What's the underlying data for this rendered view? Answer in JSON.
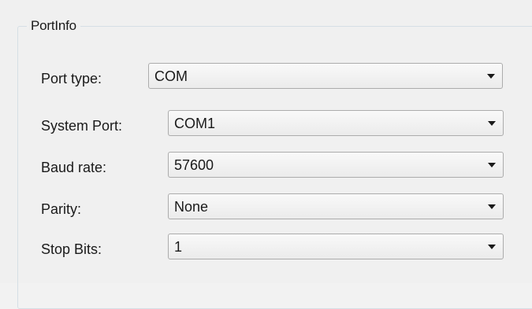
{
  "group": {
    "title": "PortInfo"
  },
  "fields": {
    "port_type": {
      "label": "Port type:",
      "value": "COM",
      "icon": "chevron-down-icon"
    },
    "system_port": {
      "label": "System Port:",
      "value": "COM1",
      "icon": "chevron-down-icon"
    },
    "baud_rate": {
      "label": "Baud rate:",
      "value": "57600",
      "icon": "chevron-down-icon"
    },
    "parity": {
      "label": "Parity:",
      "value": "None",
      "icon": "chevron-down-icon"
    },
    "stop_bits": {
      "label": "Stop Bits:",
      "value": "1",
      "icon": "chevron-down-icon"
    }
  },
  "colors": {
    "background": "#f0f0f0",
    "group_border": "#d5dfe5",
    "combo_border": "#acacac",
    "text": "#1a1a1a"
  }
}
